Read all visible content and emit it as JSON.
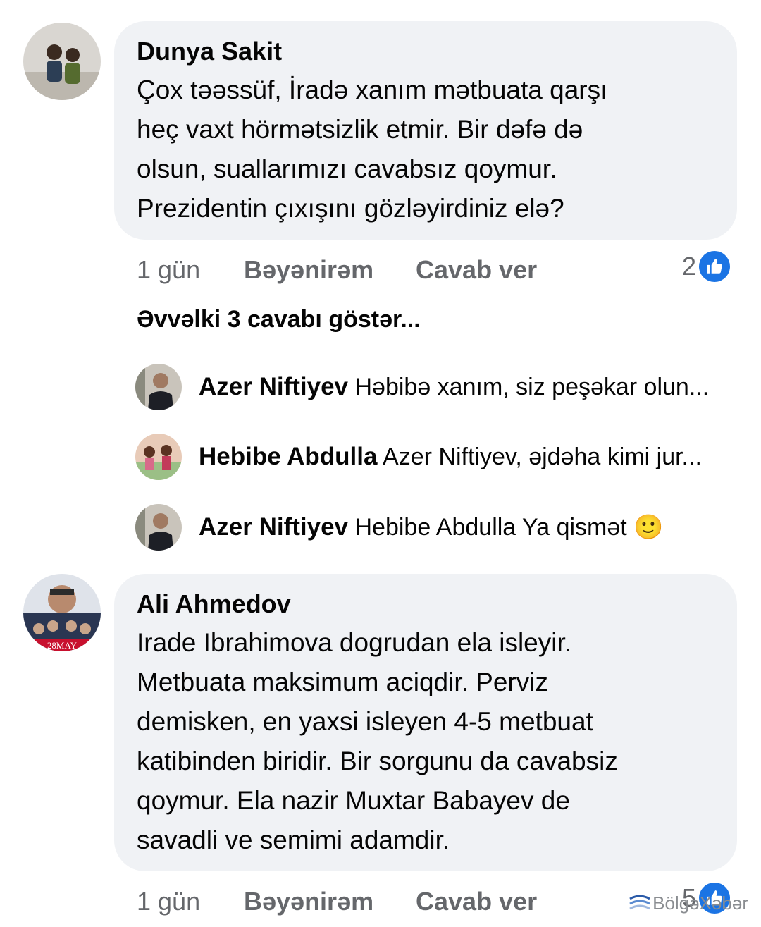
{
  "comments": [
    {
      "author": "Dunya Sakit",
      "text": "Çox təəssüf, İradə xanım mətbuata qarşı\nheç vaxt hörmətsizlik etmir. Bir dəfə də\nolsun, suallarımızı cavabsız qoymur.\nPrezidentin çıxışını gözləyirdiniz elə?",
      "time": "1 gün",
      "like_label": "Bəyənirəm",
      "reply_label": "Cavab ver",
      "reaction_count": "2"
    },
    {
      "author": "Ali Ahmedov",
      "text": "Irade Ibrahimova dogrudan ela isleyir.\nMetbuata maksimum aciqdir. Perviz\ndemisken, en yaxsi isleyen 4-5 metbuat\nkatibinden biridir. Bir sorgunu da cavabsiz\nqoymur. Ela nazir Muxtar Babayev de\nsavadli ve semimi adamdir.",
      "time": "1 gün",
      "like_label": "Bəyənirəm",
      "reply_label": "Cavab ver",
      "reaction_count": "5",
      "avatar_caption": "28MAY"
    }
  ],
  "show_previous": "Əvvəlki 3 cavabı göstər...",
  "replies": [
    {
      "author": "Azer Niftiyev",
      "snippet": "Həbibə xanım, siz peşəkar olun..."
    },
    {
      "author": "Hebibe Abdulla",
      "snippet": "Azer Niftiyev, əjdəha kimi jur..."
    },
    {
      "author": "Azer Niftiyev",
      "snippet": "Hebibe Abdulla Ya qismət 🙂"
    }
  ],
  "watermark": "BölgəXəbər",
  "colors": {
    "bubble": "#f0f2f5",
    "meta": "#65676b",
    "like": "#1b74e4"
  }
}
